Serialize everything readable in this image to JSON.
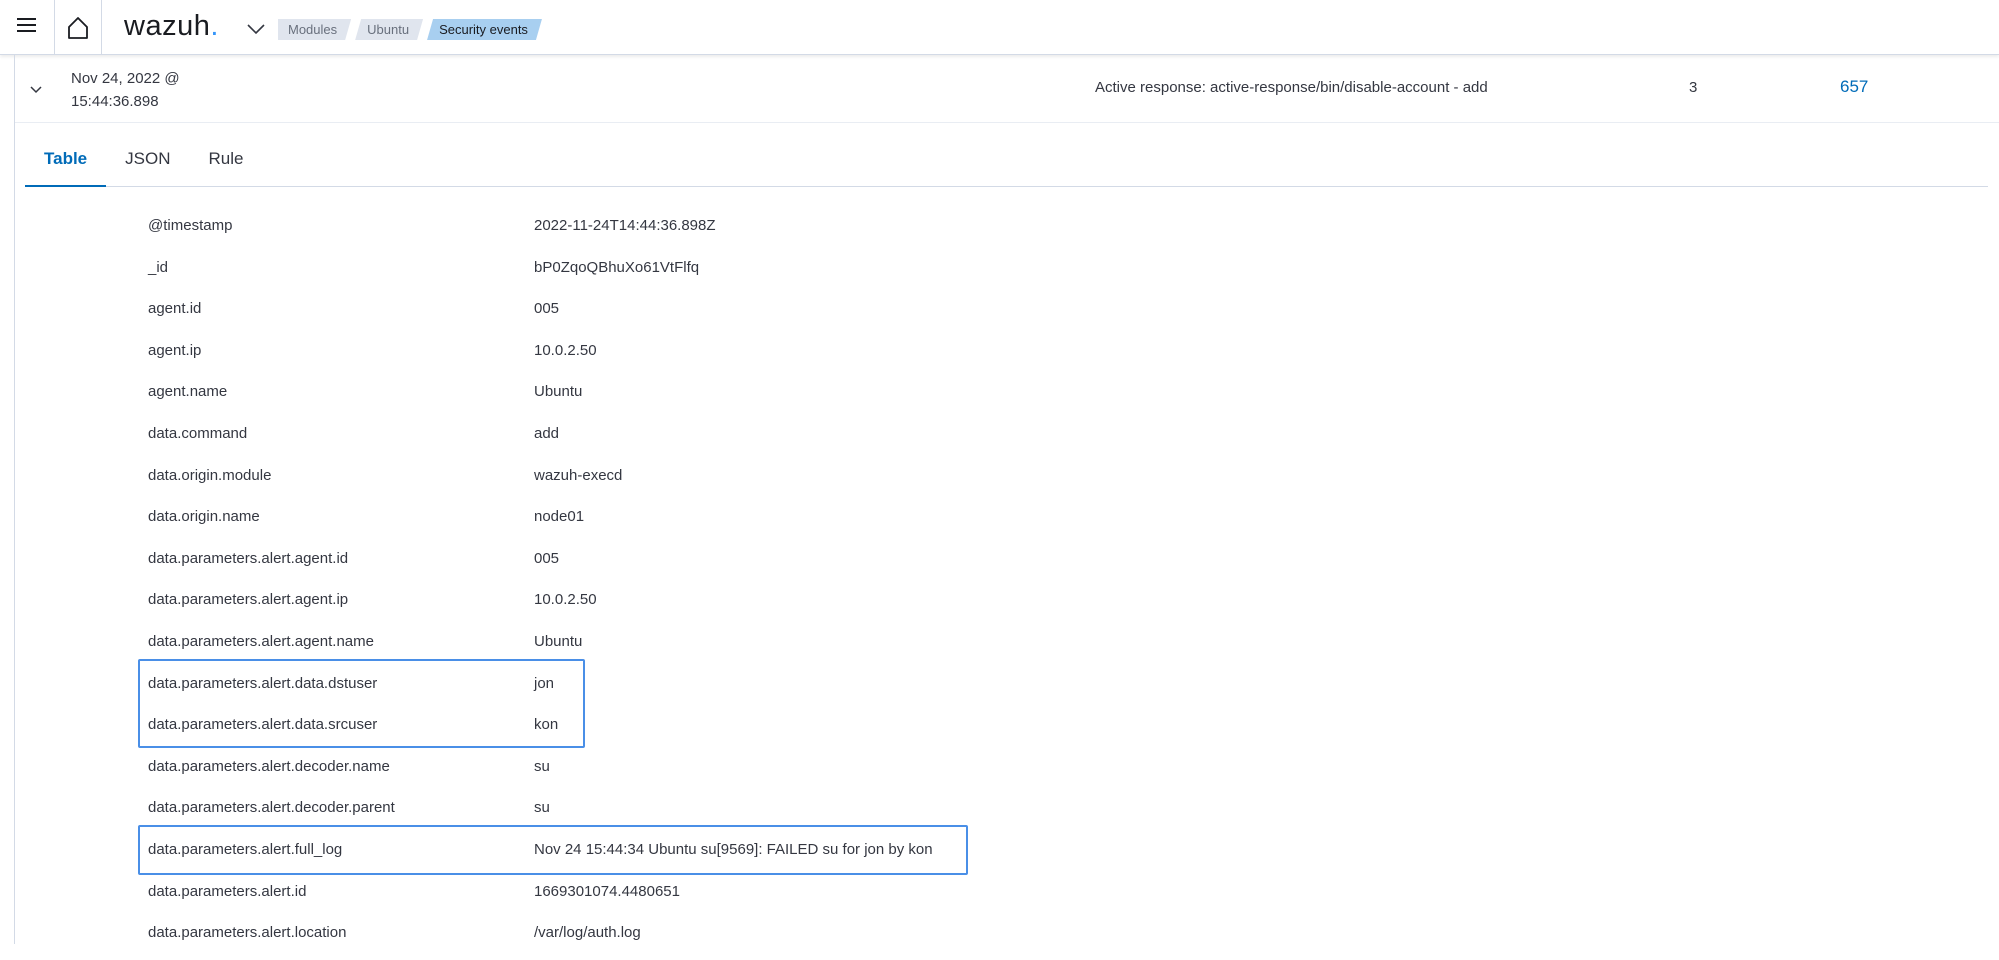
{
  "header": {
    "logo_text": "wazuh",
    "logo_dot": ".",
    "breadcrumbs": [
      "Modules",
      "Ubuntu",
      "Security events"
    ]
  },
  "event": {
    "date_line1": "Nov 24, 2022 @",
    "date_line2": "15:44:36.898",
    "description": "Active response: active-response/bin/disable-account - add",
    "level": "3",
    "rule_id": "657"
  },
  "tabs": [
    "Table",
    "JSON",
    "Rule"
  ],
  "fields": [
    {
      "key": "@timestamp",
      "value": "2022-11-24T14:44:36.898Z"
    },
    {
      "key": "_id",
      "value": "bP0ZqoQBhuXo61VtFlfq"
    },
    {
      "key": "agent.id",
      "value": "005"
    },
    {
      "key": "agent.ip",
      "value": "10.0.2.50"
    },
    {
      "key": "agent.name",
      "value": "Ubuntu"
    },
    {
      "key": "data.command",
      "value": "add"
    },
    {
      "key": "data.origin.module",
      "value": "wazuh-execd"
    },
    {
      "key": "data.origin.name",
      "value": "node01"
    },
    {
      "key": "data.parameters.alert.agent.id",
      "value": "005"
    },
    {
      "key": "data.parameters.alert.agent.ip",
      "value": "10.0.2.50"
    },
    {
      "key": "data.parameters.alert.agent.name",
      "value": "Ubuntu"
    },
    {
      "key": "data.parameters.alert.data.dstuser",
      "value": "jon"
    },
    {
      "key": "data.parameters.alert.data.srcuser",
      "value": "kon"
    },
    {
      "key": "data.parameters.alert.decoder.name",
      "value": "su"
    },
    {
      "key": "data.parameters.alert.decoder.parent",
      "value": "su"
    },
    {
      "key": "data.parameters.alert.full_log",
      "value": "Nov 24 15:44:34 Ubuntu su[9569]: FAILED su for jon by kon"
    },
    {
      "key": "data.parameters.alert.id",
      "value": "1669301074.4480651"
    },
    {
      "key": "data.parameters.alert.location",
      "value": "/var/log/auth.log"
    }
  ],
  "colors": {
    "accent": "#006bb8",
    "highlight_box": "#4a8fe7",
    "breadcrumb_active": "#a8cff0"
  },
  "icons": [
    "menu-icon",
    "home-icon",
    "chevron-down-icon",
    "expand-chevron-icon"
  ]
}
